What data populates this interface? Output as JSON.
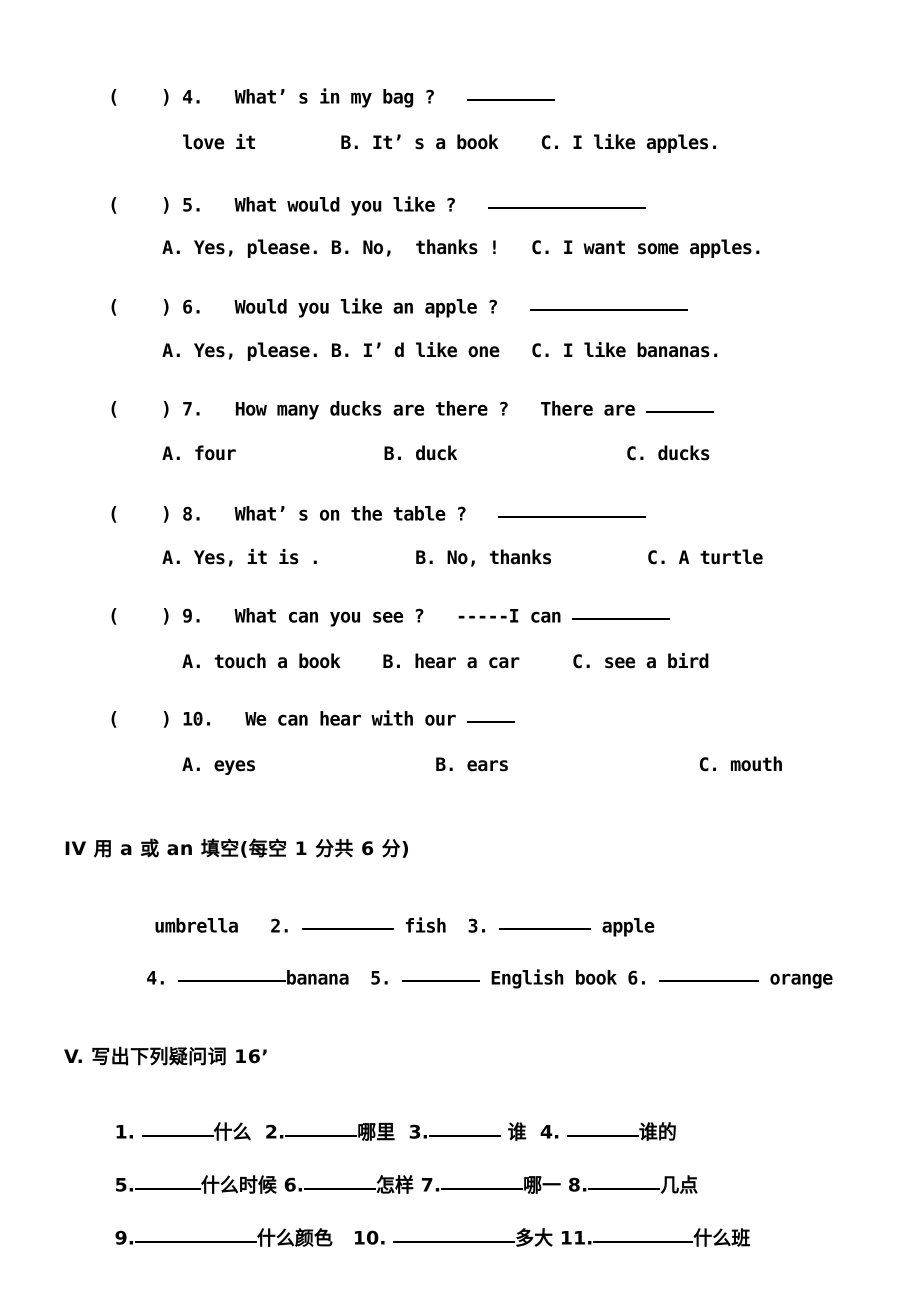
{
  "document": {
    "type": "exam-worksheet",
    "language": "English / Chinese"
  },
  "multiple_choice": {
    "questions": [
      {
        "bracket": "(    )",
        "number": "4.",
        "stem": "What’ s in my bag ?",
        "blank_width": 88,
        "options_line": "love it        B. It’ s a book    C. I like apples.",
        "options": [
          {
            "label": "",
            "text": "love it"
          },
          {
            "label": "B.",
            "text": "It’ s a book"
          },
          {
            "label": "C.",
            "text": "I like apples."
          }
        ]
      },
      {
        "bracket": "(    )",
        "number": "5.",
        "stem": "What would you like ?",
        "blank_width": 158,
        "options_line": "A. Yes, please. B. No,  thanks !   C. I want some apples.",
        "options": [
          {
            "label": "A.",
            "text": "Yes, please."
          },
          {
            "label": "B.",
            "text": "No,  thanks !"
          },
          {
            "label": "C.",
            "text": "I want some apples."
          }
        ]
      },
      {
        "bracket": "(    )",
        "number": "6.",
        "stem": "Would you like an apple ?",
        "blank_width": 158,
        "options_line": "A. Yes, please. B. I’ d like one   C. I like bananas.",
        "options": [
          {
            "label": "A.",
            "text": "Yes, please."
          },
          {
            "label": "B.",
            "text": "I’ d like one"
          },
          {
            "label": "C.",
            "text": "I like bananas."
          }
        ]
      },
      {
        "bracket": "(    )",
        "number": "7.",
        "stem": "How many ducks are there ?   There are",
        "blank_width": 68,
        "options_line": "A. four              B. duck                C. ducks",
        "options": [
          {
            "label": "A.",
            "text": "four"
          },
          {
            "label": "B.",
            "text": "duck"
          },
          {
            "label": "C.",
            "text": "ducks"
          }
        ]
      },
      {
        "bracket": "(    )",
        "number": "8.",
        "stem": "What’ s on the table ?",
        "blank_width": 148,
        "options_line": "A. Yes, it is .         B. No, thanks         C. A turtle",
        "options": [
          {
            "label": "A.",
            "text": "Yes, it is ."
          },
          {
            "label": "B.",
            "text": "No, thanks"
          },
          {
            "label": "C.",
            "text": "A turtle"
          }
        ]
      },
      {
        "bracket": "(    )",
        "number": "9.",
        "stem": "What can you see ?   -----I can",
        "blank_width": 98,
        "options_line": "A. touch a book    B. hear a car     C. see a bird",
        "options": [
          {
            "label": "A.",
            "text": "touch a book"
          },
          {
            "label": "B.",
            "text": "hear a car"
          },
          {
            "label": "C.",
            "text": "see a bird"
          }
        ]
      },
      {
        "bracket": "(    )",
        "number": "10.",
        "stem": "We can hear with our",
        "blank_width": 48,
        "options_line": "A. eyes                 B. ears                  C. mouth",
        "options": [
          {
            "label": "A.",
            "text": "eyes"
          },
          {
            "label": "B.",
            "text": "ears"
          },
          {
            "label": "C.",
            "text": "mouth"
          }
        ]
      }
    ]
  },
  "section_iv": {
    "heading": "IV 用 a 或 an 填空(每空 1 分共 6 分)",
    "line1": {
      "lead_word": "umbrella",
      "items": [
        {
          "number": "2.",
          "blank_width": 92,
          "word": "fish"
        },
        {
          "number": "3.",
          "blank_width": 92,
          "word": "apple"
        }
      ]
    },
    "line2": {
      "items": [
        {
          "number": "4.",
          "blank_width": 108,
          "word": "banana"
        },
        {
          "number": "5.",
          "blank_width": 78,
          "word": "English book"
        },
        {
          "number": "6.",
          "blank_width": 100,
          "word": "orange"
        }
      ]
    }
  },
  "section_v": {
    "heading": "V. 写出下列疑问词 16’",
    "rows": [
      [
        {
          "number": "1.",
          "blank_width": 72,
          "word": "什么"
        },
        {
          "number": "2.",
          "blank_width": 72,
          "word": "哪里"
        },
        {
          "number": "3.",
          "blank_width": 72,
          "word": "谁"
        },
        {
          "number": "4.",
          "blank_width": 72,
          "word": "谁的"
        }
      ],
      [
        {
          "number": "5.",
          "blank_width": 66,
          "word": "什么时候"
        },
        {
          "number": "6.",
          "blank_width": 72,
          "word": "怎样"
        },
        {
          "number": "7.",
          "blank_width": 82,
          "word": "哪一"
        },
        {
          "number": "8.",
          "blank_width": 72,
          "word": "几点"
        }
      ],
      [
        {
          "number": "9.",
          "blank_width": 122,
          "word": "什么颜色"
        },
        {
          "number": "10.",
          "blank_width": 122,
          "word": "多大"
        },
        {
          "number": "11.",
          "blank_width": 100,
          "word": "什么班"
        }
      ]
    ]
  }
}
